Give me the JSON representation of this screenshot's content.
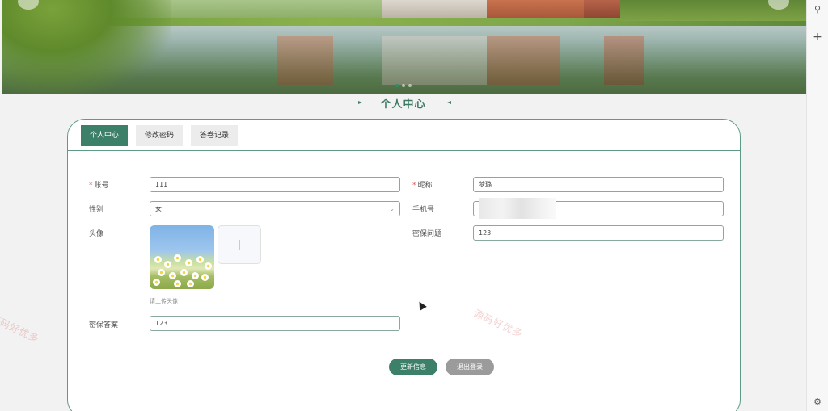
{
  "section": {
    "title": "个人中心"
  },
  "tabs": [
    {
      "label": "个人中心",
      "active": true
    },
    {
      "label": "修改密码",
      "active": false
    },
    {
      "label": "答卷记录",
      "active": false
    }
  ],
  "form": {
    "account": {
      "label": "账号",
      "required": true,
      "value": "111"
    },
    "nickname": {
      "label": "昵称",
      "required": true,
      "value": "梦璐"
    },
    "gender": {
      "label": "性别",
      "value": "女",
      "options": [
        "女"
      ]
    },
    "phone": {
      "label": "手机号",
      "value": ""
    },
    "avatar": {
      "label": "头像",
      "hint": "请上传头像",
      "upload_symbol": "+"
    },
    "security_question": {
      "label": "密保问题",
      "value": "123"
    },
    "security_answer": {
      "label": "密保答案",
      "value": "123"
    }
  },
  "buttons": {
    "update": "更新信息",
    "logout": "退出登录"
  },
  "watermarks": [
    "源码好优多",
    "源码好优多"
  ],
  "banner": {
    "slide_count": 3,
    "active_slide": 1
  },
  "browser": {
    "icons": [
      "search-icon",
      "plus-icon",
      "settings-icon"
    ]
  },
  "colors": {
    "accent": "#3d806a",
    "border": "#5f9a84",
    "logout": "#9b9b9b",
    "required": "#e05a5a"
  }
}
